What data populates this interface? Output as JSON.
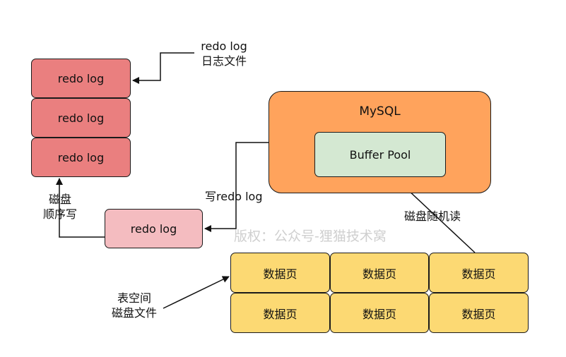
{
  "redo_file_label": [
    "redo log",
    "日志文件"
  ],
  "redo_stack": [
    "redo log",
    "redo log",
    "redo log"
  ],
  "disk_sequential_label": [
    "磁盘",
    "顺序写"
  ],
  "redo_buffer": "redo log",
  "write_redo_label": "写redo log",
  "mysql_title": "MySQL",
  "buffer_pool": "Buffer Pool",
  "random_read_label": "磁盘随机读",
  "watermark": "版权：公众号-狸猫技术窝",
  "tablespace_label": [
    "表空间",
    "磁盘文件"
  ],
  "data_pages": [
    "数据页",
    "数据页",
    "数据页",
    "数据页",
    "数据页",
    "数据页"
  ]
}
